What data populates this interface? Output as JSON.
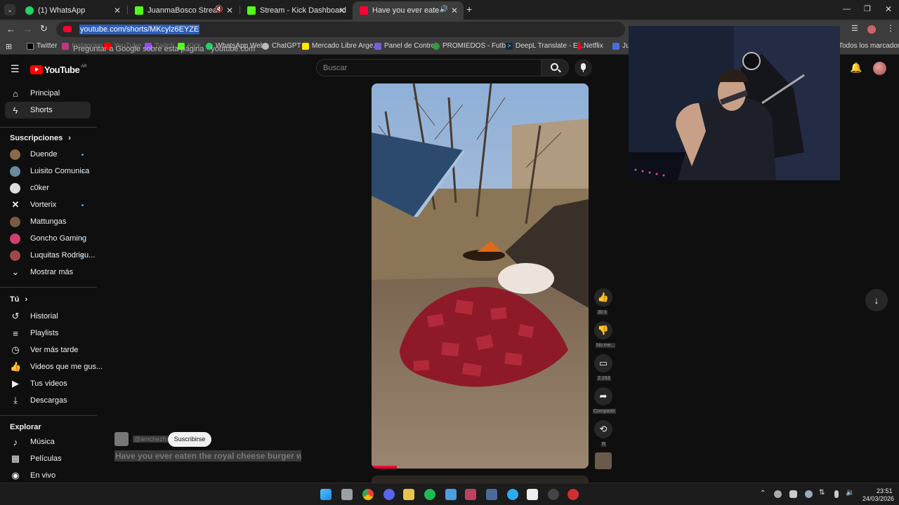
{
  "browser": {
    "tabs": [
      {
        "title": "(1) WhatsApp"
      },
      {
        "title": "JuanmaBosco Stream - Wat"
      },
      {
        "title": "Stream - Kick Dashboard"
      },
      {
        "title": "Have you ever eaten the ro"
      }
    ],
    "url": "youtube.com/shorts/MKcylz6EYZE",
    "omnibox_hint": "Preguntar a Google sobre esta página · youtube.com",
    "bookmarks": [
      "Twitter",
      "Instagram",
      "YouTube",
      "Twitch",
      "Kick",
      "WhatsApp Web",
      "ChatGPT",
      "Mercado Libre Arge...",
      "Panel de Control",
      "PROMIEDOS - Futb...",
      "DeepL Translate - El...",
      "Netflix",
      "Jua"
    ],
    "all_bookmarks": "Todos los marcadores"
  },
  "youtube": {
    "logo": "YouTube",
    "region": "AR",
    "search_placeholder": "Buscar",
    "nav": [
      {
        "label": "Principal"
      },
      {
        "label": "Shorts"
      }
    ],
    "subscriptions_title": "Suscripciones",
    "subscriptions": [
      {
        "name": "Duende",
        "dot": true
      },
      {
        "name": "Luisito Comunica",
        "dot": true
      },
      {
        "name": "c0ker",
        "dot": false
      },
      {
        "name": "Vorterix",
        "dot": true
      },
      {
        "name": "Mattungas",
        "dot": false
      },
      {
        "name": "Goncho Gaming",
        "dot": true
      },
      {
        "name": "Luquitas Rodrigu...",
        "dot": true
      }
    ],
    "show_more": "Mostrar más",
    "you_title": "Tú",
    "you_items": [
      {
        "label": "Historial"
      },
      {
        "label": "Playlists"
      },
      {
        "label": "Ver más tarde"
      },
      {
        "label": "Videos que me gus..."
      },
      {
        "label": "Tus videos"
      },
      {
        "label": "Descargas"
      }
    ],
    "explore_title": "Explorar",
    "explore_items": [
      {
        "label": "Música"
      },
      {
        "label": "Películas"
      },
      {
        "label": "En vivo"
      }
    ],
    "short": {
      "channel": "@amchezh",
      "subscribe": "Suscribirse",
      "title": "Have you ever eaten the royal cheese burger wit...",
      "likes": "30 k",
      "dislike_label": "No me...",
      "comments": "2.153",
      "share": "Compartir",
      "remix": "R"
    }
  },
  "taskbar": {
    "time": "23:51",
    "date": "24/03/2026"
  }
}
